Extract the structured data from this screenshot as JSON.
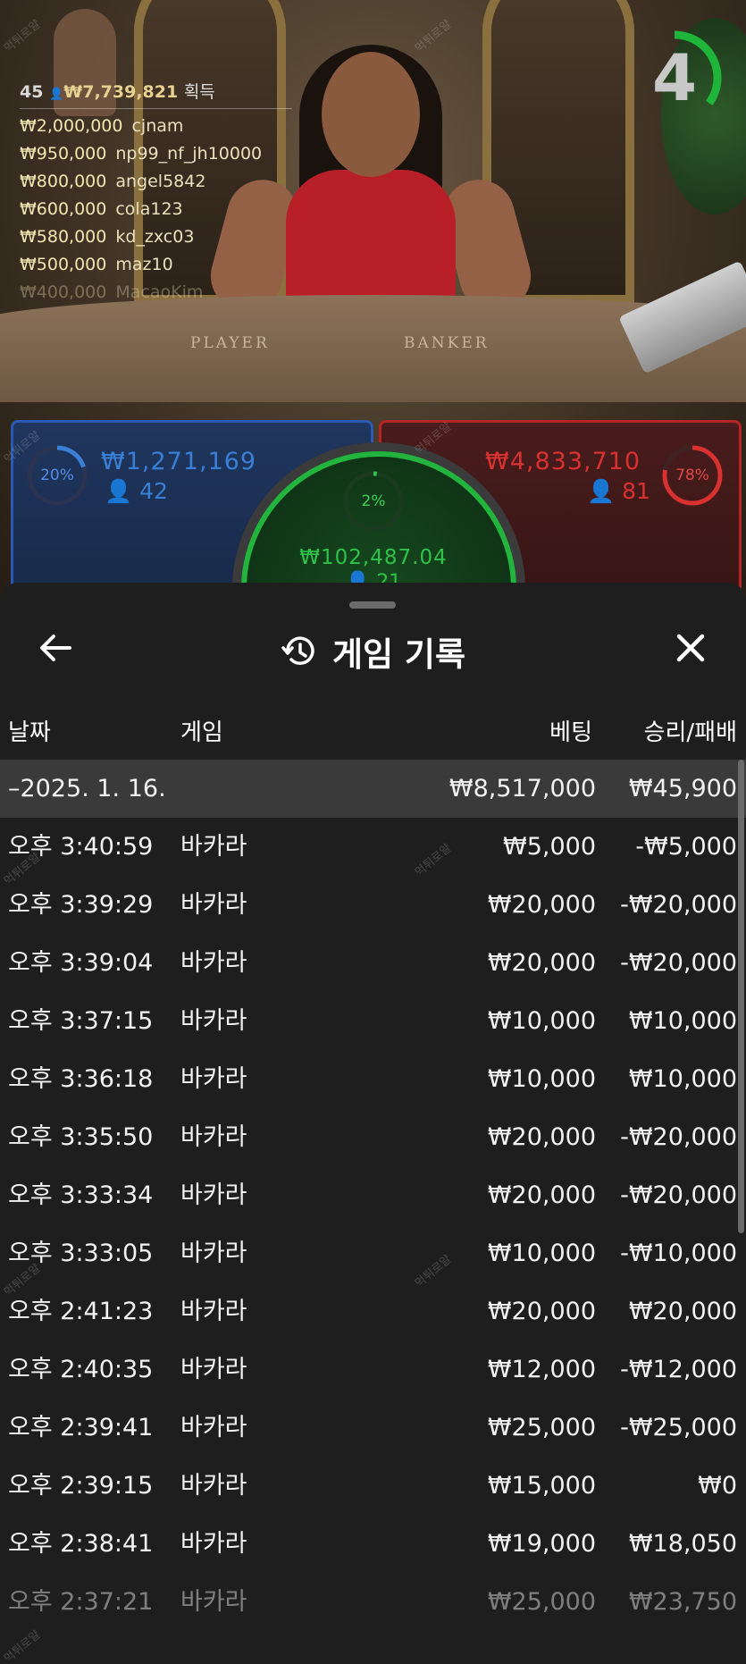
{
  "stream": {
    "table_player_label": "PLAYER",
    "table_banker_label": "BANKER",
    "countdown": "4",
    "countdown_fraction": 0.35
  },
  "winners": {
    "count": "45",
    "total": "₩7,739,821",
    "suffix": "획득",
    "list": [
      {
        "amount": "₩2,000,000",
        "name": "cjnam"
      },
      {
        "amount": "₩950,000",
        "name": "np99_nf_jh10000"
      },
      {
        "amount": "₩800,000",
        "name": "angel5842"
      },
      {
        "amount": "₩600,000",
        "name": "cola123"
      },
      {
        "amount": "₩580,000",
        "name": "kd_zxc03"
      },
      {
        "amount": "₩500,000",
        "name": "maz10"
      },
      {
        "amount": "₩400,000",
        "name": "MacaoKim"
      }
    ]
  },
  "bets": {
    "player": {
      "percent_label": "20%",
      "percent": 20,
      "amount": "₩1,271,169",
      "players": "42",
      "color": "#3a7fd6"
    },
    "banker": {
      "percent_label": "78%",
      "percent": 78,
      "amount": "₩4,833,710",
      "players": "81",
      "color": "#d93030"
    },
    "tie": {
      "percent_label": "2%",
      "percent": 2,
      "amount": "₩102,487.04",
      "players": "21",
      "color": "#2fc24a"
    }
  },
  "history": {
    "title": "게임 기록",
    "back_icon": "arrow-left-icon",
    "title_icon": "history-clock-icon",
    "close_icon": "close-icon",
    "columns": {
      "date": "날짜",
      "game": "게임",
      "bet": "베팅",
      "result": "승리/패배"
    },
    "group": {
      "date": "–2025. 1. 16.",
      "bet": "₩8,517,000",
      "result": "₩45,900"
    },
    "rows": [
      {
        "time": "오후 3:40:59",
        "game": "바카라",
        "bet": "₩5,000",
        "result": "-₩5,000"
      },
      {
        "time": "오후 3:39:29",
        "game": "바카라",
        "bet": "₩20,000",
        "result": "-₩20,000"
      },
      {
        "time": "오후 3:39:04",
        "game": "바카라",
        "bet": "₩20,000",
        "result": "-₩20,000"
      },
      {
        "time": "오후 3:37:15",
        "game": "바카라",
        "bet": "₩10,000",
        "result": "₩10,000"
      },
      {
        "time": "오후 3:36:18",
        "game": "바카라",
        "bet": "₩10,000",
        "result": "₩10,000"
      },
      {
        "time": "오후 3:35:50",
        "game": "바카라",
        "bet": "₩20,000",
        "result": "-₩20,000"
      },
      {
        "time": "오후 3:33:34",
        "game": "바카라",
        "bet": "₩20,000",
        "result": "-₩20,000"
      },
      {
        "time": "오후 3:33:05",
        "game": "바카라",
        "bet": "₩10,000",
        "result": "-₩10,000"
      },
      {
        "time": "오후 2:41:23",
        "game": "바카라",
        "bet": "₩20,000",
        "result": "₩20,000"
      },
      {
        "time": "오후 2:40:35",
        "game": "바카라",
        "bet": "₩12,000",
        "result": "-₩12,000"
      },
      {
        "time": "오후 2:39:41",
        "game": "바카라",
        "bet": "₩25,000",
        "result": "-₩25,000"
      },
      {
        "time": "오후 2:39:15",
        "game": "바카라",
        "bet": "₩15,000",
        "result": "₩0"
      },
      {
        "time": "오후 2:38:41",
        "game": "바카라",
        "bet": "₩19,000",
        "result": "₩18,050"
      },
      {
        "time": "오후 2:37:21",
        "game": "바카라",
        "bet": "₩25,000",
        "result": "₩23,750"
      }
    ]
  },
  "watermark_text": "먹튀로얄"
}
